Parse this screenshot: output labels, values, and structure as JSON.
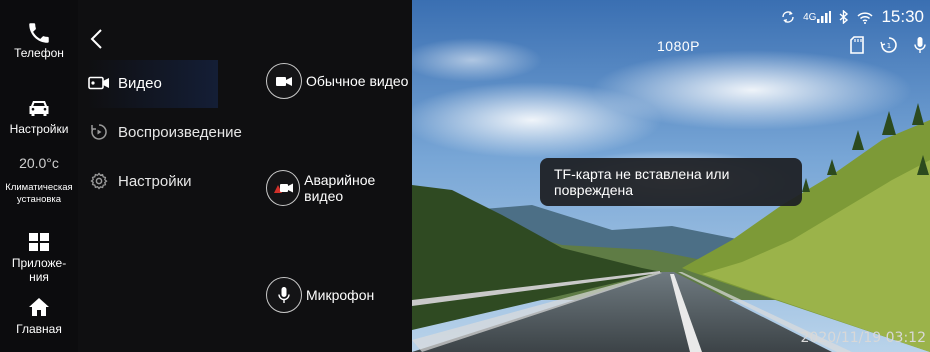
{
  "dock": {
    "phone_label": "Телефон",
    "settings_label": "Настройки",
    "temperature": "20.0°c",
    "climate_label_1": "Климатическая",
    "climate_label_2": "установка",
    "apps_label_1": "Приложе-",
    "apps_label_2": "ния",
    "home_label": "Главная"
  },
  "menu": {
    "items": [
      {
        "label": "Видео",
        "icon": "video-camera-icon",
        "selected": true
      },
      {
        "label": "Воспроизведение",
        "icon": "playback-icon"
      },
      {
        "label": "Настройки",
        "icon": "gear-icon"
      }
    ]
  },
  "options": [
    {
      "label": "Обычное видео",
      "icon": "camera-icon"
    },
    {
      "label": "Аварийное видео",
      "icon": "emergency-camera-icon"
    },
    {
      "label": "Микрофон",
      "icon": "microphone-icon"
    }
  ],
  "camera": {
    "resolution": "1080P",
    "toast": "TF-карта не вставлена или повреждена",
    "timestamp": "2020/11/19 03:12"
  },
  "status": {
    "network": "4G",
    "time": "15:30"
  },
  "colors": {
    "dock_bg": "#0c0c0e",
    "panel_bg": "#0f0f11",
    "selection": "#141e36",
    "emergency_red": "#d0302a"
  }
}
